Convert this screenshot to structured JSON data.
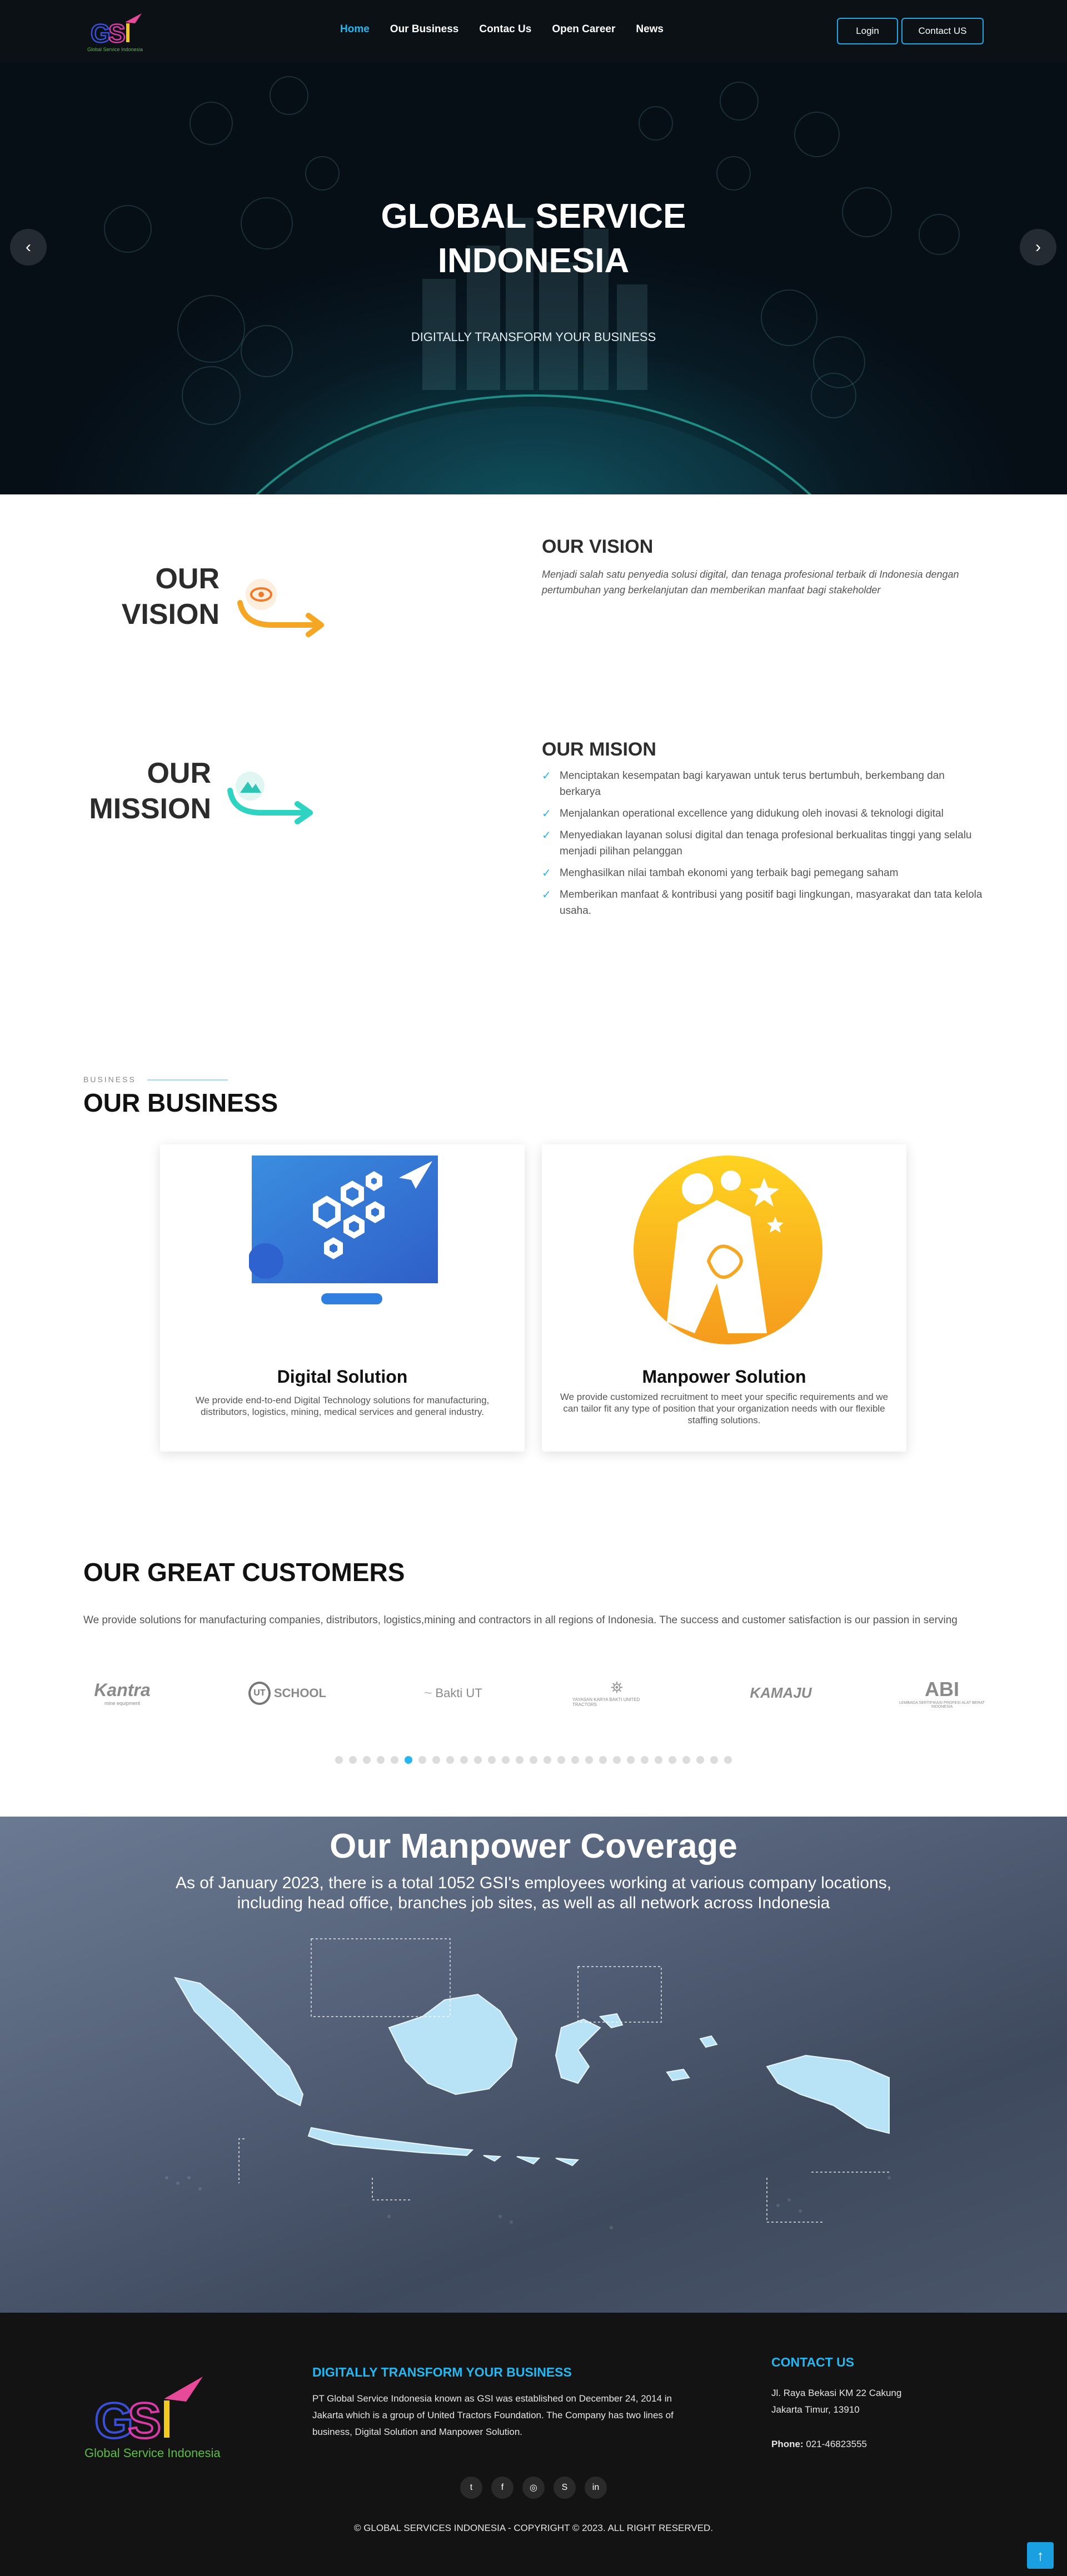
{
  "colors": {
    "accent": "#27b6f0",
    "nav_bg": "#0b1115",
    "footer_bg": "#131313",
    "vision_orange": "#f5a623",
    "mission_teal": "#2ed3c2"
  },
  "nav": {
    "logo_text": "GSI",
    "logo_tagline": "Global Service Indonesia",
    "links": [
      "Home",
      "Our Business",
      "Contac Us",
      "Open Career",
      "News"
    ],
    "login_label": "Login",
    "contact_label": "Contact US"
  },
  "hero": {
    "title_line1": "GLOBAL SERVICE",
    "title_line2": "INDONESIA",
    "subtitle": "DIGITALLY TRANSFORM YOUR BUSINESS",
    "prev_icon": "chevron-left-icon",
    "next_icon": "chevron-right-icon"
  },
  "vision": {
    "badge_line1": "OUR",
    "badge_line2": "VISION",
    "title": "OUR VISION",
    "text": "Menjadi salah satu penyedia solusi digital, dan tenaga profesional terbaik di Indonesia dengan pertumbuhan yang berkelanjutan dan memberikan manfaat bagi stakeholder"
  },
  "mission": {
    "badge_line1": "OUR",
    "badge_line2": "MISSION",
    "title": "OUR MISION",
    "items": [
      "Menciptakan kesempatan bagi karyawan untuk terus bertumbuh, berkembang dan berkarya",
      "Menjalankan operational excellence yang didukung oleh inovasi & teknologi digital",
      "Menyediakan layanan solusi digital dan tenaga profesional berkualitas tinggi yang selalu menjadi pilihan pelanggan",
      "Menghasilkan nilai tambah ekonomi yang terbaik bagi pemegang saham",
      "Memberikan manfaat & kontribusi yang positif bagi lingkungan, masyarakat dan tata kelola usaha."
    ]
  },
  "business": {
    "kicker": "BUSINESS",
    "title": "OUR BUSINESS",
    "cards": [
      {
        "title": "Digital Solution",
        "desc": "We provide end-to-end Digital Technology solutions for manufacturing, distributors, logistics, mining, medical services and general industry."
      },
      {
        "title": "Manpower Solution",
        "desc": "We provide customized recruitment to meet your specific requirements and we can tailor fit any type of position that your organization needs with our flexible staffing solutions."
      }
    ]
  },
  "customers": {
    "title": "OUR GREAT CUSTOMERS",
    "desc": "We provide solutions for manufacturing companies, distributors, logistics,mining and contractors in all regions of Indonesia. The success and customer satisfaction is our passion in serving",
    "logos": [
      "Kantra",
      "SCHOOL",
      "Bakti UT",
      "YAYASAN KARYA BAKTI UNITED TRACTORS",
      "KAMAJU",
      "ABI"
    ],
    "logo_small": [
      "mine equipment",
      "",
      "",
      "",
      "",
      "LEMBAGA SERTIFIKASI PROFESI ALAT BERAT INDONESIA"
    ],
    "dot_count": 29,
    "active_dot": 5
  },
  "coverage": {
    "title": "Our Manpower Coverage",
    "subtitle": "As of January 2023, there is a total 1052 GSI's employees working at various company locations, including head office, branches job sites, as well as all network across Indonesia"
  },
  "footer": {
    "logo_text": "GSI",
    "logo_tagline": "Global Service Indonesia",
    "about_title": "DIGITALLY TRANSFORM YOUR BUSINESS",
    "about_text": "PT Global Service Indonesia known as GSI was established on December 24, 2014 in Jakarta which is a group of United Tractors Foundation. The Company has two lines of business, Digital Solution and Manpower Solution.",
    "contact_title": "CONTACT US",
    "address_line1": "Jl. Raya Bekasi KM 22 Cakung",
    "address_line2": "Jakarta Timur, 13910",
    "phone_label": "Phone:",
    "phone_value": "021-46823555",
    "social_icons": [
      "twitter-icon",
      "facebook-icon",
      "instagram-icon",
      "skype-icon",
      "linkedin-icon"
    ],
    "social_glyphs": [
      "t",
      "f",
      "◎",
      "S",
      "in"
    ],
    "copyright": "© GLOBAL SERVICES INDONESIA - COPYRIGHT © 2023. ALL RIGHT RESERVED.",
    "to_top": "↑"
  }
}
